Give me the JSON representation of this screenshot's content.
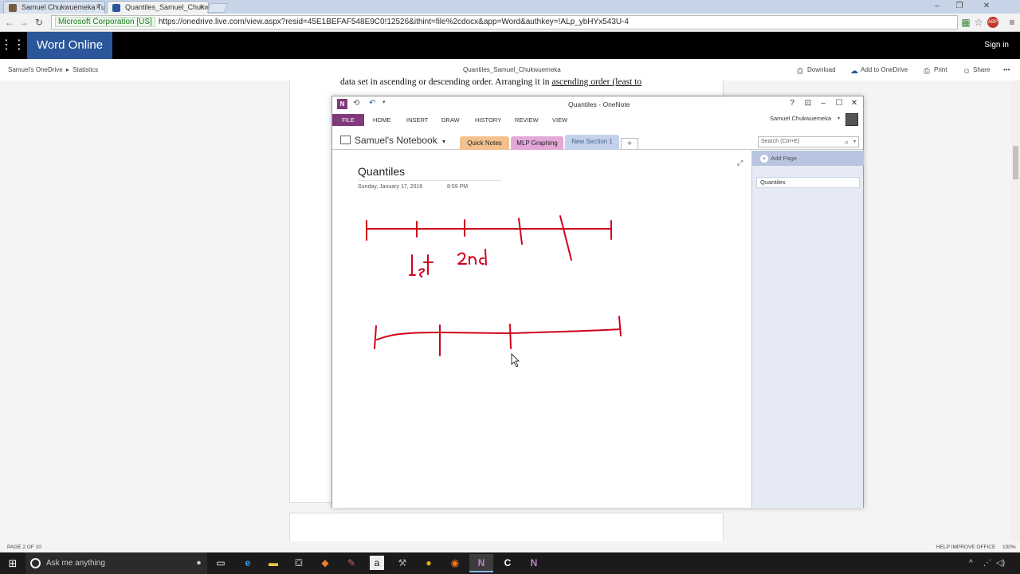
{
  "browser": {
    "tabs": [
      {
        "label": "Samuel Chukwuemeka Tu"
      },
      {
        "label": "Quantiles_Samuel_Chukw"
      }
    ],
    "tab_close": "×",
    "url": {
      "cert": "Microsoft Corporation [US]",
      "text": "https://onedrive.live.com/view.aspx?resid=45E1BEFAF548E9C0!12526&ithint=file%2cdocx&app=Word&authkey=!ALp_ybHYx543U-4"
    },
    "window_controls": {
      "minimize": "–",
      "restore": "❐",
      "close": "✕"
    },
    "nav": {
      "back": "←",
      "forward": "→",
      "reload": "↻"
    },
    "toolbar_icons": {
      "ext": "▦",
      "star": "☆",
      "abp": "ABP",
      "menu": "≡"
    }
  },
  "word": {
    "waffle": "⋮⋮⋮",
    "app_title": "Word Online",
    "sign_in": "Sign in",
    "breadcrumb": {
      "root": "Samuel's OneDrive",
      "sep": "▸",
      "folder": "Statistics"
    },
    "doc_title": "Quantiles_Samuel_Chukwuemeka",
    "commands": {
      "download": "Download",
      "add_onedrive": "Add to OneDrive",
      "print": "Print",
      "share": "Share",
      "more": "•••"
    },
    "doc_text_plain": "data set in ascending or descending order. Arranging  it in ",
    "doc_text_underlined": "ascending order (least to",
    "status_left": "PAGE 2 OF 10",
    "status_right_1": "HELP IMPROVE OFFICE",
    "status_right_2": "100%"
  },
  "onenote": {
    "title": "Quantiles - OneNote",
    "logo": "N",
    "quick_icons": {
      "back": "⟲",
      "undo": "↶",
      "dropdown": "▾"
    },
    "window_icons": {
      "help": "?",
      "fullscreen": "⊡",
      "minimize": "–",
      "maximize": "☐",
      "close": "✕"
    },
    "ribbon_tabs": [
      "FILE",
      "HOME",
      "INSERT",
      "DRAW",
      "HISTORY",
      "REVIEW",
      "VIEW"
    ],
    "user": "Samuel Chukwuemeka",
    "user_caret": "▾",
    "notebook": "Samuel's Notebook",
    "notebook_caret": "▾",
    "sections": [
      {
        "label": "Quick Notes",
        "color": "#f4c18e"
      },
      {
        "label": "MLP Graphing",
        "color": "#e4a8d8"
      },
      {
        "label": "New Section 1",
        "color": "#c3d2ea"
      }
    ],
    "add_section": "+",
    "search_placeholder": "Search (Ctrl+E)",
    "search_icon": "⌕",
    "page_title": "Quantiles",
    "page_date": "Sunday, January 17, 2016",
    "page_time": "8:59 PM",
    "expand_icon": "⤢",
    "add_page": "Add Page",
    "add_page_plus": "+",
    "pages": [
      "Quantiles"
    ],
    "ink_color": "#d0021b"
  },
  "taskbar": {
    "start_icon": "⊞",
    "search_placeholder": "Ask me anything",
    "mic": "🎤",
    "apps": [
      {
        "name": "task-view",
        "glyph": "▭"
      },
      {
        "name": "edge",
        "glyph": "e"
      },
      {
        "name": "file-explorer",
        "glyph": "▬"
      },
      {
        "name": "store",
        "glyph": "⛋"
      },
      {
        "name": "app-orange",
        "glyph": "◆"
      },
      {
        "name": "app-paint",
        "glyph": "✎"
      },
      {
        "name": "amazon",
        "glyph": "a"
      },
      {
        "name": "tools",
        "glyph": "⚒"
      },
      {
        "name": "chrome",
        "glyph": "●"
      },
      {
        "name": "firefox",
        "glyph": "◉"
      },
      {
        "name": "onenote",
        "glyph": "N"
      },
      {
        "name": "camtasia",
        "glyph": "C"
      },
      {
        "name": "onenote-2",
        "glyph": "N"
      }
    ],
    "tray": {
      "chevron": "^",
      "network": "⋰",
      "volume": "◁)"
    }
  }
}
